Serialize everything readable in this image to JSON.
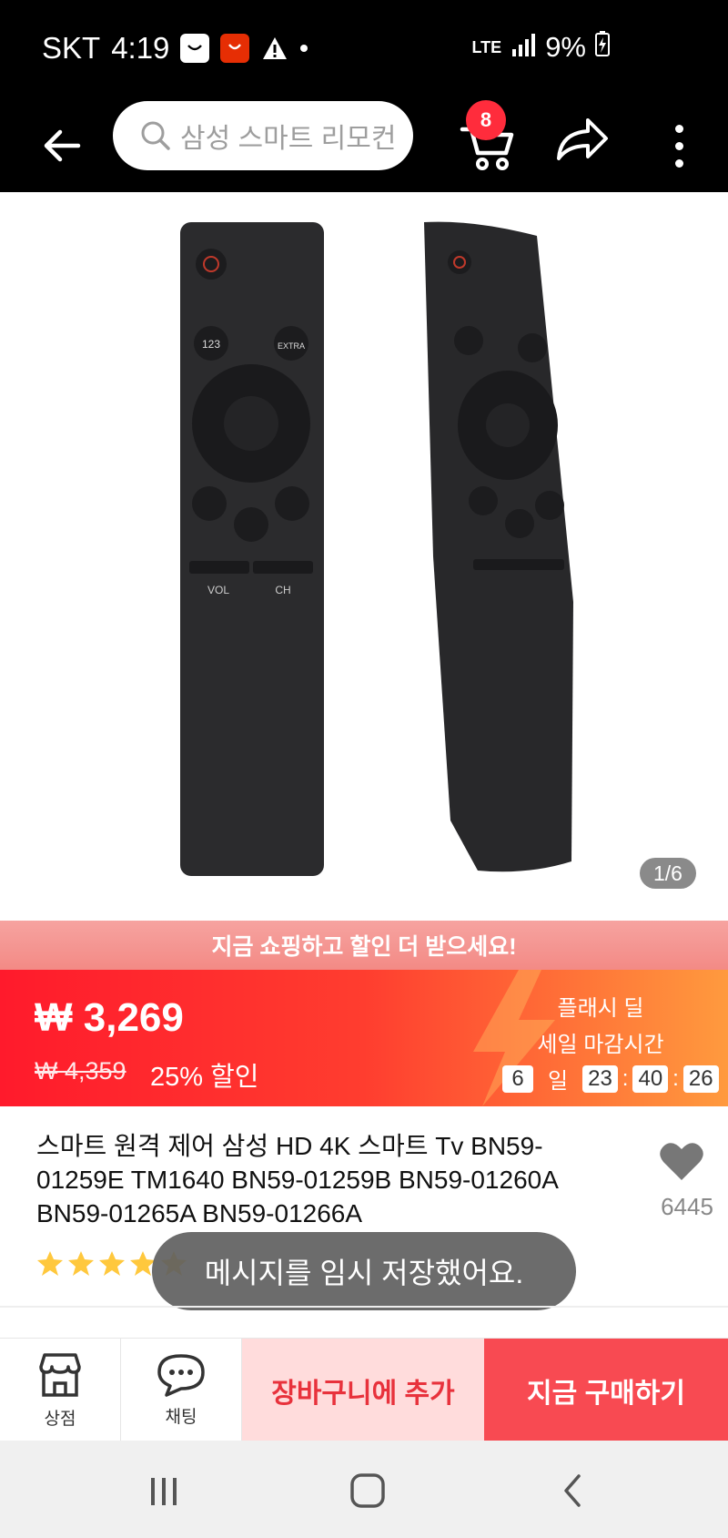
{
  "status_bar": {
    "carrier": "SKT",
    "time": "4:19",
    "network": "LTE",
    "battery": "9%",
    "icons": [
      "app-notification-icon",
      "aliexpress-notification-icon",
      "warning-icon",
      "dot-icon",
      "lte-icon",
      "signal-icon",
      "battery-charging-icon"
    ]
  },
  "toolbar": {
    "search_placeholder": "삼성 스마트 리모컨",
    "cart_count": "8",
    "icons": [
      "back-arrow-icon",
      "search-icon",
      "cart-icon",
      "share-icon",
      "more-vertical-icon"
    ]
  },
  "gallery": {
    "counter": "1/6",
    "remote_labels": {
      "num": "123",
      "extra": "EXTRA",
      "vol": "VOL",
      "ch": "CH"
    }
  },
  "promo": {
    "text": "지금 쇼핑하고 할인 더 받으세요!"
  },
  "price": {
    "current": "₩ 3,269",
    "original": "₩ 4,359",
    "discount": "25% 할인"
  },
  "flash_deal": {
    "title": "플래시 딜",
    "subtitle": "세일 마감시간",
    "days": "6",
    "day_label": "일",
    "hours": "23",
    "minutes": "40",
    "seconds": "26",
    "separator": ":"
  },
  "product": {
    "title": "스마트 원격 제어 삼성 HD 4K 스마트 Tv BN59-01259E TM1640 BN59-01259B BN59-01260A BN59-01265A BN59-01266A",
    "wishlist_count": "6445",
    "rating_stars": 5
  },
  "toast": {
    "message": "메시지를 임시 저장했어요."
  },
  "action_bar": {
    "store_label": "상점",
    "chat_label": "채팅",
    "add_to_cart": "장바구니에 추가",
    "buy_now": "지금 구매하기"
  },
  "colors": {
    "accent_red": "#ff1a2c",
    "accent_orange": "#ff9a3e",
    "buy_now_bg": "#f84a52",
    "add_cart_bg": "#ffdcdc",
    "star": "#ffc83d"
  }
}
